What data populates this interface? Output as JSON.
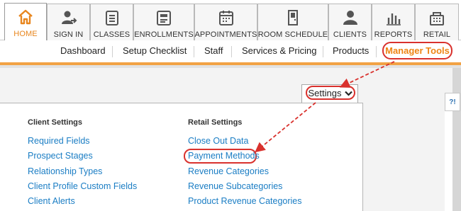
{
  "topnav": {
    "tabs": [
      {
        "label": "HOME",
        "icon": "home-icon",
        "active": true
      },
      {
        "label": "SIGN IN",
        "icon": "sign-in-icon"
      },
      {
        "label": "CLASSES",
        "icon": "classes-icon"
      },
      {
        "label": "ENROLLMENTS",
        "icon": "enrollments-icon"
      },
      {
        "label": "APPOINTMENTS",
        "icon": "appointments-icon"
      },
      {
        "label": "ROOM SCHEDULE",
        "icon": "room-schedule-icon"
      },
      {
        "label": "CLIENTS",
        "icon": "clients-icon"
      },
      {
        "label": "REPORTS",
        "icon": "reports-icon"
      },
      {
        "label": "RETAIL",
        "icon": "retail-icon"
      }
    ]
  },
  "subnav": {
    "items": [
      "Dashboard",
      "Setup Checklist",
      "Staff",
      "Services & Pricing",
      "Products"
    ],
    "manager_tools": "Manager Tools"
  },
  "toolbar": {
    "settings_label": "Settings"
  },
  "help_label": "?!",
  "panel": {
    "client_settings": {
      "heading": "Client Settings",
      "links": [
        "Required Fields",
        "Prospect Stages",
        "Relationship Types",
        "Client Profile Custom Fields",
        "Client Alerts"
      ]
    },
    "retail_settings": {
      "heading": "Retail Settings",
      "links": [
        "Close Out Data",
        "Payment Methods",
        "Revenue Categories",
        "Revenue Subcategories",
        "Product Revenue Categories"
      ]
    }
  },
  "colors": {
    "accent_orange": "#ee8413",
    "highlight_red": "#d9312d",
    "link_blue": "#1a7dc4"
  }
}
